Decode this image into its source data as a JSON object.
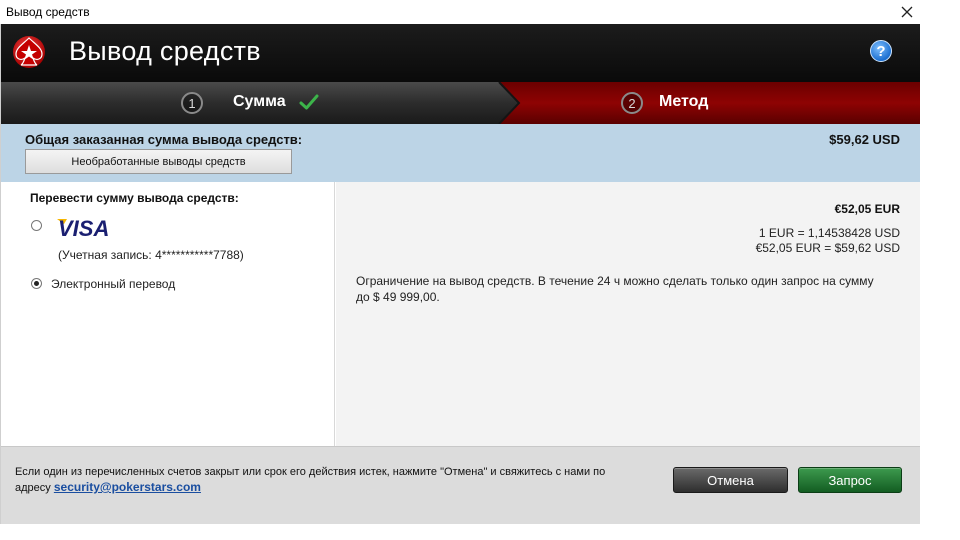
{
  "window": {
    "title": "Вывод средств"
  },
  "header": {
    "title": "Вывод средств",
    "help_label": "?"
  },
  "steps": [
    {
      "number": "1",
      "label": "Сумма",
      "completed": true
    },
    {
      "number": "2",
      "label": "Метод",
      "active": true
    }
  ],
  "total": {
    "label": "Общая заказанная сумма вывода средств:",
    "value": "$59,62 USD",
    "unprocessed_button": "Необработанные выводы средств"
  },
  "methods": {
    "heading": "Перевести сумму вывода средств:",
    "visa": {
      "logo_text": "VISA",
      "account": "(Учетная запись: 4***********7788)",
      "checked": false
    },
    "eft": {
      "label": "Электронный перевод",
      "checked": true
    }
  },
  "details": {
    "amount": "€52,05 EUR",
    "rate": "1 EUR = 1,14538428 USD",
    "conversion": "€52,05 EUR = $59,62 USD",
    "limit_text": "Ограничение на вывод средств. В течение 24 ч можно сделать только один запрос на сумму до $ 49 999,00."
  },
  "footer": {
    "text": "Если один из перечисленных счетов закрыт или срок его действия истек, нажмите \"Отмена\" и свяжитесь с нами по адресу",
    "link": "security@pokerstars.com",
    "cancel_button": "Отмена",
    "request_button": "Запрос"
  },
  "colors": {
    "header_bg": "#111111",
    "steps_active": "#8e0303",
    "total_band": "#bcd4e6",
    "request_button": "#1f7a33",
    "check_green": "#3cb44a",
    "visa_blue": "#1a1f71",
    "visa_gold": "#f7b600"
  },
  "icons": {
    "close": "close-icon",
    "help": "help-icon",
    "logo": "pokerstars-logo",
    "check": "checkmark-icon"
  }
}
